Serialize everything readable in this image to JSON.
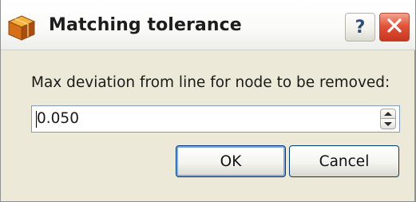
{
  "window": {
    "title": "Matching tolerance",
    "help_label": "?",
    "icons": {
      "app": "cube-icon",
      "help": "help-icon",
      "close": "close-icon"
    }
  },
  "form": {
    "prompt": "Max deviation from line for node to be removed:",
    "value": "0.050"
  },
  "buttons": {
    "ok": "OK",
    "cancel": "Cancel"
  },
  "colors": {
    "dialog_background": "#ece9d8",
    "close_button": "#e2543a",
    "default_button_focus": "#7ea6e3",
    "input_border": "#7f9db9"
  }
}
